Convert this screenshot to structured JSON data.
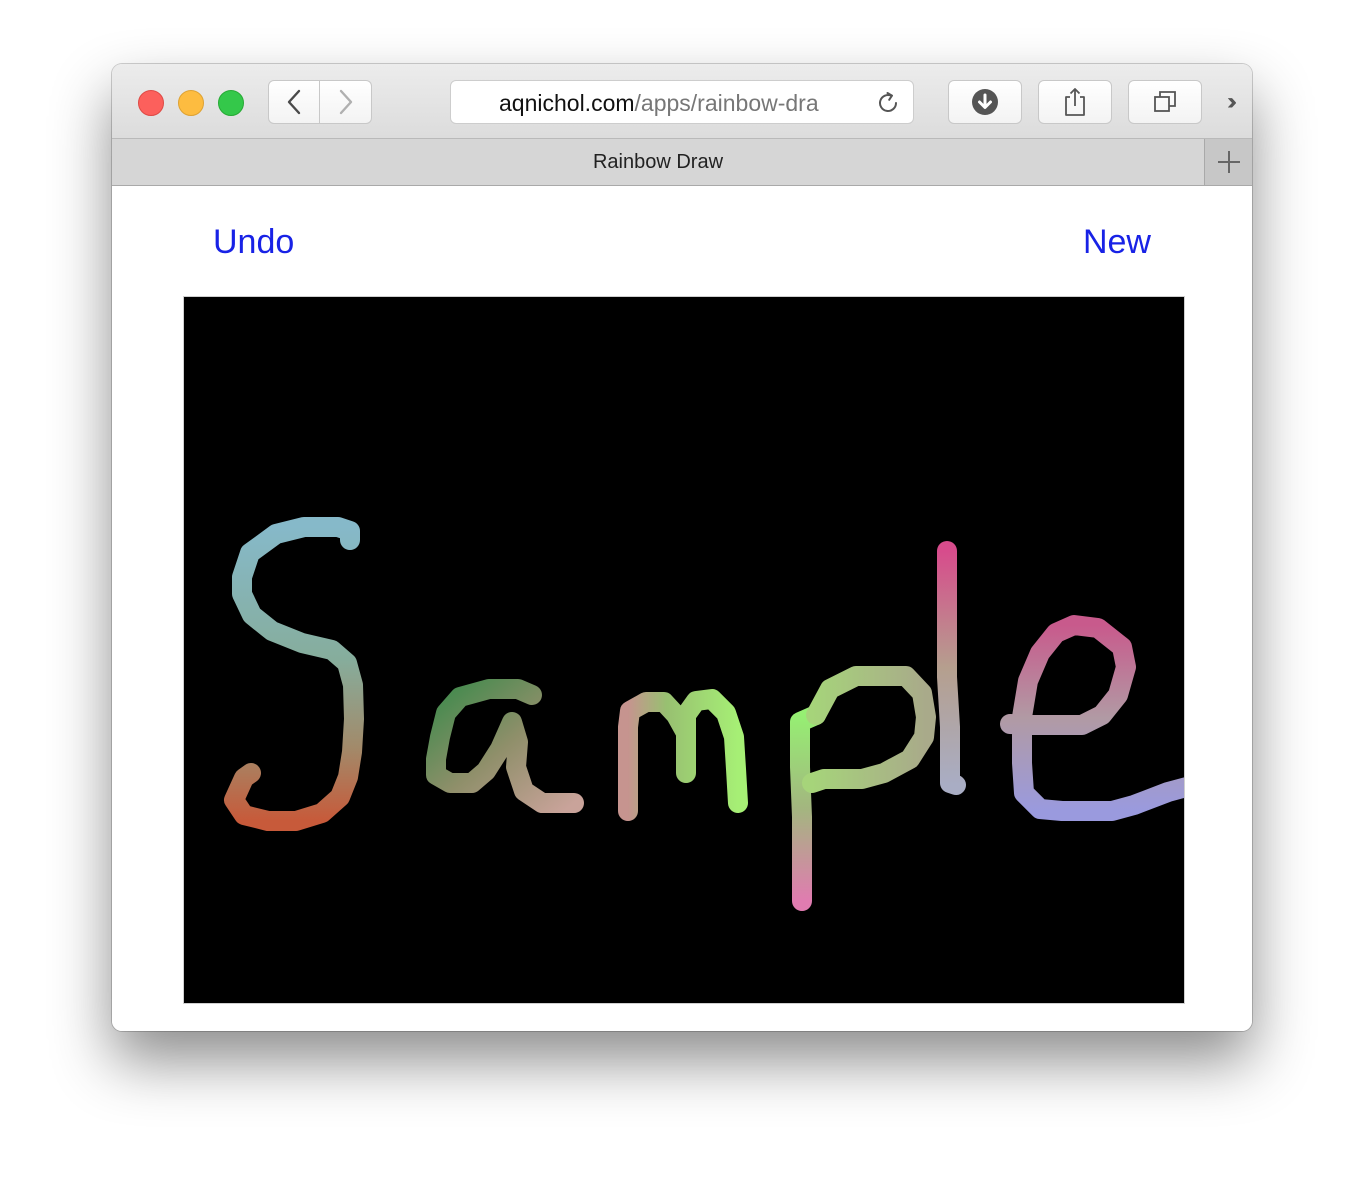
{
  "browser": {
    "url_domain": "aqnichol.com",
    "url_path": "/apps/rainbow-dra",
    "tab_title": "Rainbow Draw",
    "more_label": "››"
  },
  "page": {
    "undo_label": "Undo",
    "new_label": "New",
    "drawing_word": "Sample"
  },
  "icons": {
    "back": "chevron-left-icon",
    "forward": "chevron-right-icon",
    "reload": "reload-icon",
    "download": "download-icon",
    "share": "share-icon",
    "tabs": "tabs-overview-icon",
    "new_tab": "plus-icon"
  },
  "colors": {
    "link": "#1822e6",
    "canvas_background": "#000000"
  }
}
